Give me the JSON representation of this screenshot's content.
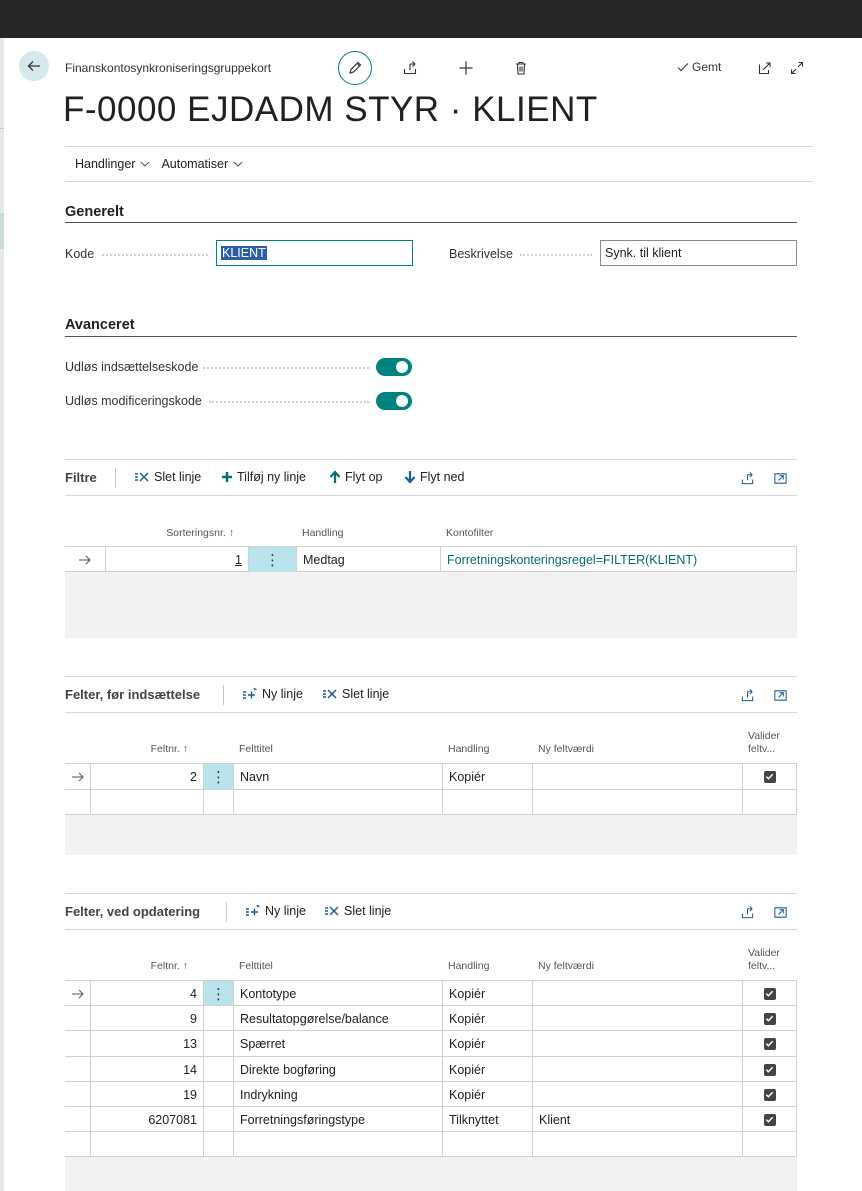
{
  "header": {
    "breadcrumb": "Finanskontosynkroniseringsgruppekort",
    "saved_label": "Gemt",
    "title": "F-0000 EJDADM STYR · KLIENT"
  },
  "actionbar": {
    "actions": [
      "Handlinger",
      "Automatiser"
    ]
  },
  "general": {
    "title": "Generelt",
    "code_label": "Kode",
    "code_value": "KLIENT",
    "description_label": "Beskrivelse",
    "description_value": "Synk. til klient"
  },
  "advanced": {
    "title": "Avanceret",
    "insert_label": "Udløs indsættelseskode",
    "insert_on": true,
    "modify_label": "Udløs modificeringskode",
    "modify_on": true
  },
  "filters": {
    "title": "Filtre",
    "actions": [
      "Slet linje",
      "Tilføj ny linje",
      "Flyt op",
      "Flyt ned"
    ],
    "columns": [
      "Sorteringsnr. ↑",
      "Handling",
      "Kontofilter"
    ],
    "rows": [
      {
        "sort_no": "1",
        "action": "Medtag",
        "filter": "Forretningskonteringsregel=FILTER(KLIENT)"
      }
    ]
  },
  "fields_insert": {
    "title": "Felter, før indsættelse",
    "actions": [
      "Ny linje",
      "Slet linje"
    ],
    "columns": [
      "Feltnr. ↑",
      "Felttitel",
      "Handling",
      "Ny feltværdi",
      "Valider",
      "feltv..."
    ],
    "rows": [
      {
        "no": "2",
        "name": "Navn",
        "action": "Kopiér",
        "value": "",
        "validate": true
      }
    ]
  },
  "fields_update": {
    "title": "Felter, ved opdatering",
    "actions": [
      "Ny linje",
      "Slet linje"
    ],
    "columns": [
      "Feltnr. ↑",
      "Felttitel",
      "Handling",
      "Ny feltværdi",
      "Valider",
      "feltv..."
    ],
    "rows": [
      {
        "no": "4",
        "name": "Kontotype",
        "action": "Kopiér",
        "value": "",
        "validate": true
      },
      {
        "no": "9",
        "name": "Resultatopgørelse/balance",
        "action": "Kopiér",
        "value": "",
        "validate": true
      },
      {
        "no": "13",
        "name": "Spærret",
        "action": "Kopiér",
        "value": "",
        "validate": true
      },
      {
        "no": "14",
        "name": "Direkte bogføring",
        "action": "Kopiér",
        "value": "",
        "validate": true
      },
      {
        "no": "19",
        "name": "Indrykning",
        "action": "Kopiér",
        "value": "",
        "validate": true
      },
      {
        "no": "6207081",
        "name": "Forretningsføringstype",
        "action": "Tilknyttet",
        "value": "Klient",
        "validate": true
      }
    ]
  },
  "colors": {
    "accent": "#00827f",
    "selected_cell": "#b9e4ec",
    "header_bar": "#262626"
  }
}
